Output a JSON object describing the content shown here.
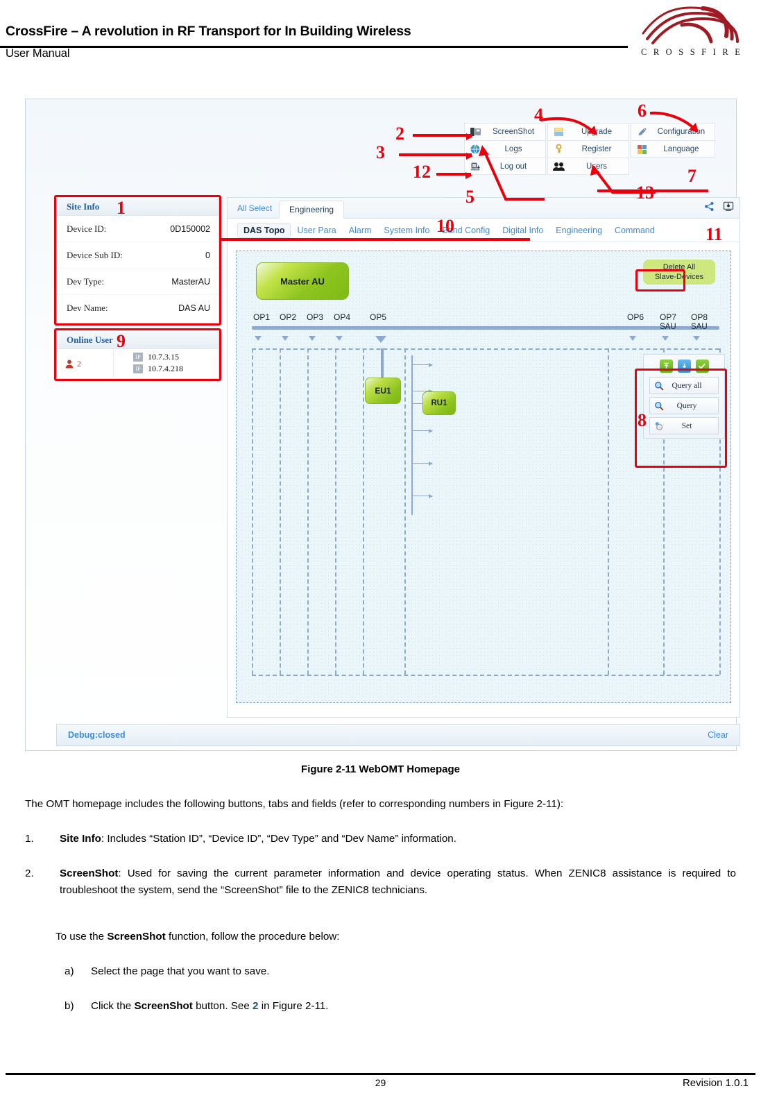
{
  "header": {
    "title": "CrossFire – A revolution in RF Transport for In Building Wireless",
    "subtitle": "User Manual",
    "logo_text": "C R O S S F I R E"
  },
  "screenshot": {
    "toolbar": {
      "columns": [
        [
          {
            "label": "ScreenShot",
            "icon": "screenshot-icon"
          },
          {
            "label": "Logs",
            "icon": "logs-globe-icon"
          },
          {
            "label": "Log out",
            "icon": "logout-icon"
          }
        ],
        [
          {
            "label": "Upgrade",
            "icon": "upgrade-icon"
          },
          {
            "label": "Register",
            "icon": "register-key-icon"
          },
          {
            "label": "Users",
            "icon": "users-icon"
          }
        ],
        [
          {
            "label": "Configuration",
            "icon": "configuration-icon"
          },
          {
            "label": "Language",
            "icon": "language-icon"
          }
        ]
      ]
    },
    "site_info": {
      "title": "Site Info",
      "rows": [
        {
          "key": "Device ID:",
          "value": "0D150002"
        },
        {
          "key": "Device Sub ID:",
          "value": "0"
        },
        {
          "key": "Dev Type:",
          "value": "MasterAU"
        },
        {
          "key": "Dev Name:",
          "value": "DAS AU"
        }
      ]
    },
    "online_user": {
      "title": "Online User",
      "count": "2",
      "ip_label": "IP",
      "ips": [
        "10.7.3.15",
        "10.7.4.218"
      ]
    },
    "main_panel": {
      "all_select": "All Select",
      "active_top_tab": "Engineering",
      "sub_tabs": [
        "DAS Topo",
        "User Para",
        "Alarm",
        "System Info",
        "Band Config",
        "Digital Info",
        "Engineering",
        "Command"
      ],
      "active_sub_tab": "DAS Topo",
      "share_icon": "share-icon",
      "download_icon": "download-icon"
    },
    "topology": {
      "master_node": "Master AU",
      "delete_all_line1": "Delete All",
      "delete_all_line2": "Slave-Devices",
      "ports_left": [
        "OP1",
        "OP2",
        "OP3",
        "OP4",
        "OP5"
      ],
      "ports_right": [
        "OP6",
        "OP7",
        "OP8"
      ],
      "sau_labels": [
        "SAU",
        "SAU"
      ],
      "eu_node": "EU1",
      "ru_node": "RU1"
    },
    "action_panel": {
      "icons": [
        "upload-icon",
        "download-icon",
        "check-icon"
      ],
      "buttons": [
        {
          "label": "Query all",
          "icon": "magnifier-icon"
        },
        {
          "label": "Query",
          "icon": "magnifier-icon"
        },
        {
          "label": "Set",
          "icon": "set-gear-icon"
        }
      ]
    },
    "debug": {
      "status": "Debug:closed",
      "clear": "Clear"
    },
    "annotations": [
      "1",
      "2",
      "3",
      "4",
      "5",
      "6",
      "7",
      "8",
      "9",
      "10",
      "11",
      "12",
      "13"
    ]
  },
  "caption": "Figure 2-11 WebOMT Homepage",
  "body": {
    "intro": "The OMT homepage includes the following buttons, tabs and fields (refer to corresponding numbers in Figure 2-11):",
    "item1_num": "1.",
    "item1_bold": "Site Info",
    "item1_rest": ": Includes “Station ID”, “Device ID”, “Dev Type” and “Dev Name” information.",
    "item2_num": "2.",
    "item2_bold": "ScreenShot",
    "item2_rest": ": Used for saving the current parameter information and device operating status. When ZENIC8 assistance is required to troubleshoot the system, send the “ScreenShot” file to the ZENIC8 technicians.",
    "item2_sub_pre": "To use the ",
    "item2_sub_bold": "ScreenShot",
    "item2_sub_post": " function, follow the procedure below:",
    "sub_a_marker": "a)",
    "sub_a_text": "Select the page that you want to save.",
    "sub_b_marker": "b)",
    "sub_b_pre": "Click the ",
    "sub_b_bold": "ScreenShot",
    "sub_b_mid": " button. See ",
    "sub_b_ref": "2",
    "sub_b_post": " in Figure 2-11."
  },
  "footer": {
    "page_number": "29",
    "revision": "Revision 1.0.1"
  }
}
